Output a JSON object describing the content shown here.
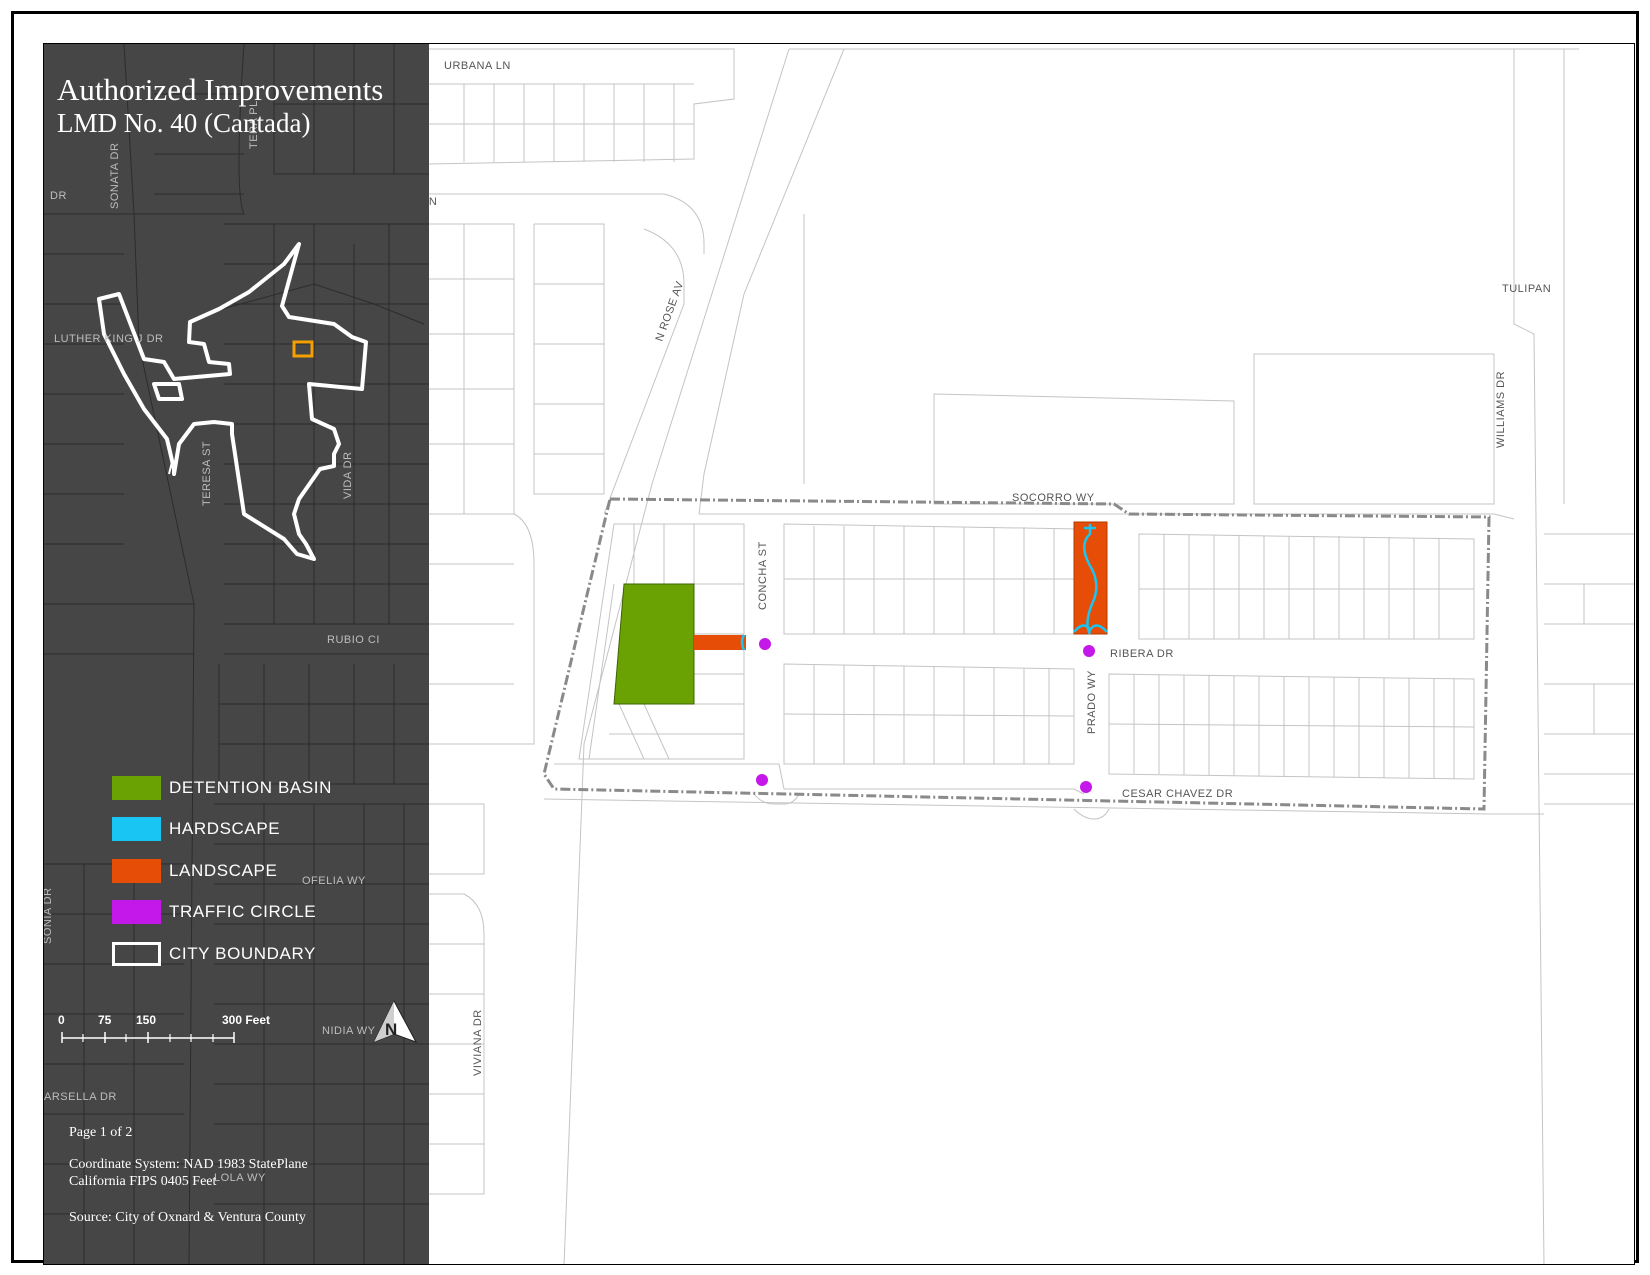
{
  "title": {
    "line1": "Authorized Improvements",
    "line2": "LMD No. 40 (Cantada)"
  },
  "legend": [
    {
      "label": "DETENTION BASIN",
      "color": "#6aa204",
      "style": "fill"
    },
    {
      "label": "HARDSCAPE",
      "color": "#19c5f2",
      "style": "fill"
    },
    {
      "label": "LANDSCAPE",
      "color": "#e64e07",
      "style": "fill"
    },
    {
      "label": "TRAFFIC CIRCLE",
      "color": "#c417ea",
      "style": "fill"
    },
    {
      "label": "CITY BOUNDARY",
      "color": "#ffffff",
      "style": "outline"
    }
  ],
  "scale_bar": {
    "labels": [
      "0",
      "75",
      "150",
      "300 Feet"
    ]
  },
  "north_arrow": {
    "label": "N"
  },
  "notes": {
    "page": "Page 1 of 2",
    "coord_line1": "Coordinate System: NAD 1983 StatePlane",
    "coord_line2": "California FIPS 0405 Feet",
    "source": "Source: City of Oxnard & Ventura County"
  },
  "streets": {
    "urbana_ln": "URBANA LN",
    "tiesa_ln": "TIESA LN",
    "n_rose_av": "N ROSE AV",
    "tulipan": "TULIPAN",
    "williams_dr": "WILLIAMS DR",
    "socorro_wy": "SOCORRO WY",
    "concha_st": "CONCHA ST",
    "ribera_dr": "RIBERA DR",
    "prado_wy": "PRADO WY",
    "cesar_chavez_dr": "CESAR CHAVEZ DR",
    "viviana_dr": "VIVIANA DR",
    "ofelia_wy": "OFELIA WY",
    "nidia_wy": "NIDIA WY",
    "lola_wy": "LOLA WY",
    "arsella_dr": "ARSELLA DR",
    "sonia_dr": "SONIA DR",
    "rubio_ci": "RUBIO CI",
    "teresa_st": "TERESA ST",
    "vida_dr": "VIDA DR",
    "sonata_dr": "SONATA DR",
    "luther_king_j_dr": "LUTHER KING J DR",
    "dr": "DR",
    "tera_pl": "TERA PL"
  },
  "colors": {
    "panel": "#464646",
    "detention_basin": "#6aa204",
    "hardscape": "#19c5f2",
    "landscape": "#e64e07",
    "traffic_circle": "#c417ea",
    "locator_marker": "#f5a000"
  }
}
